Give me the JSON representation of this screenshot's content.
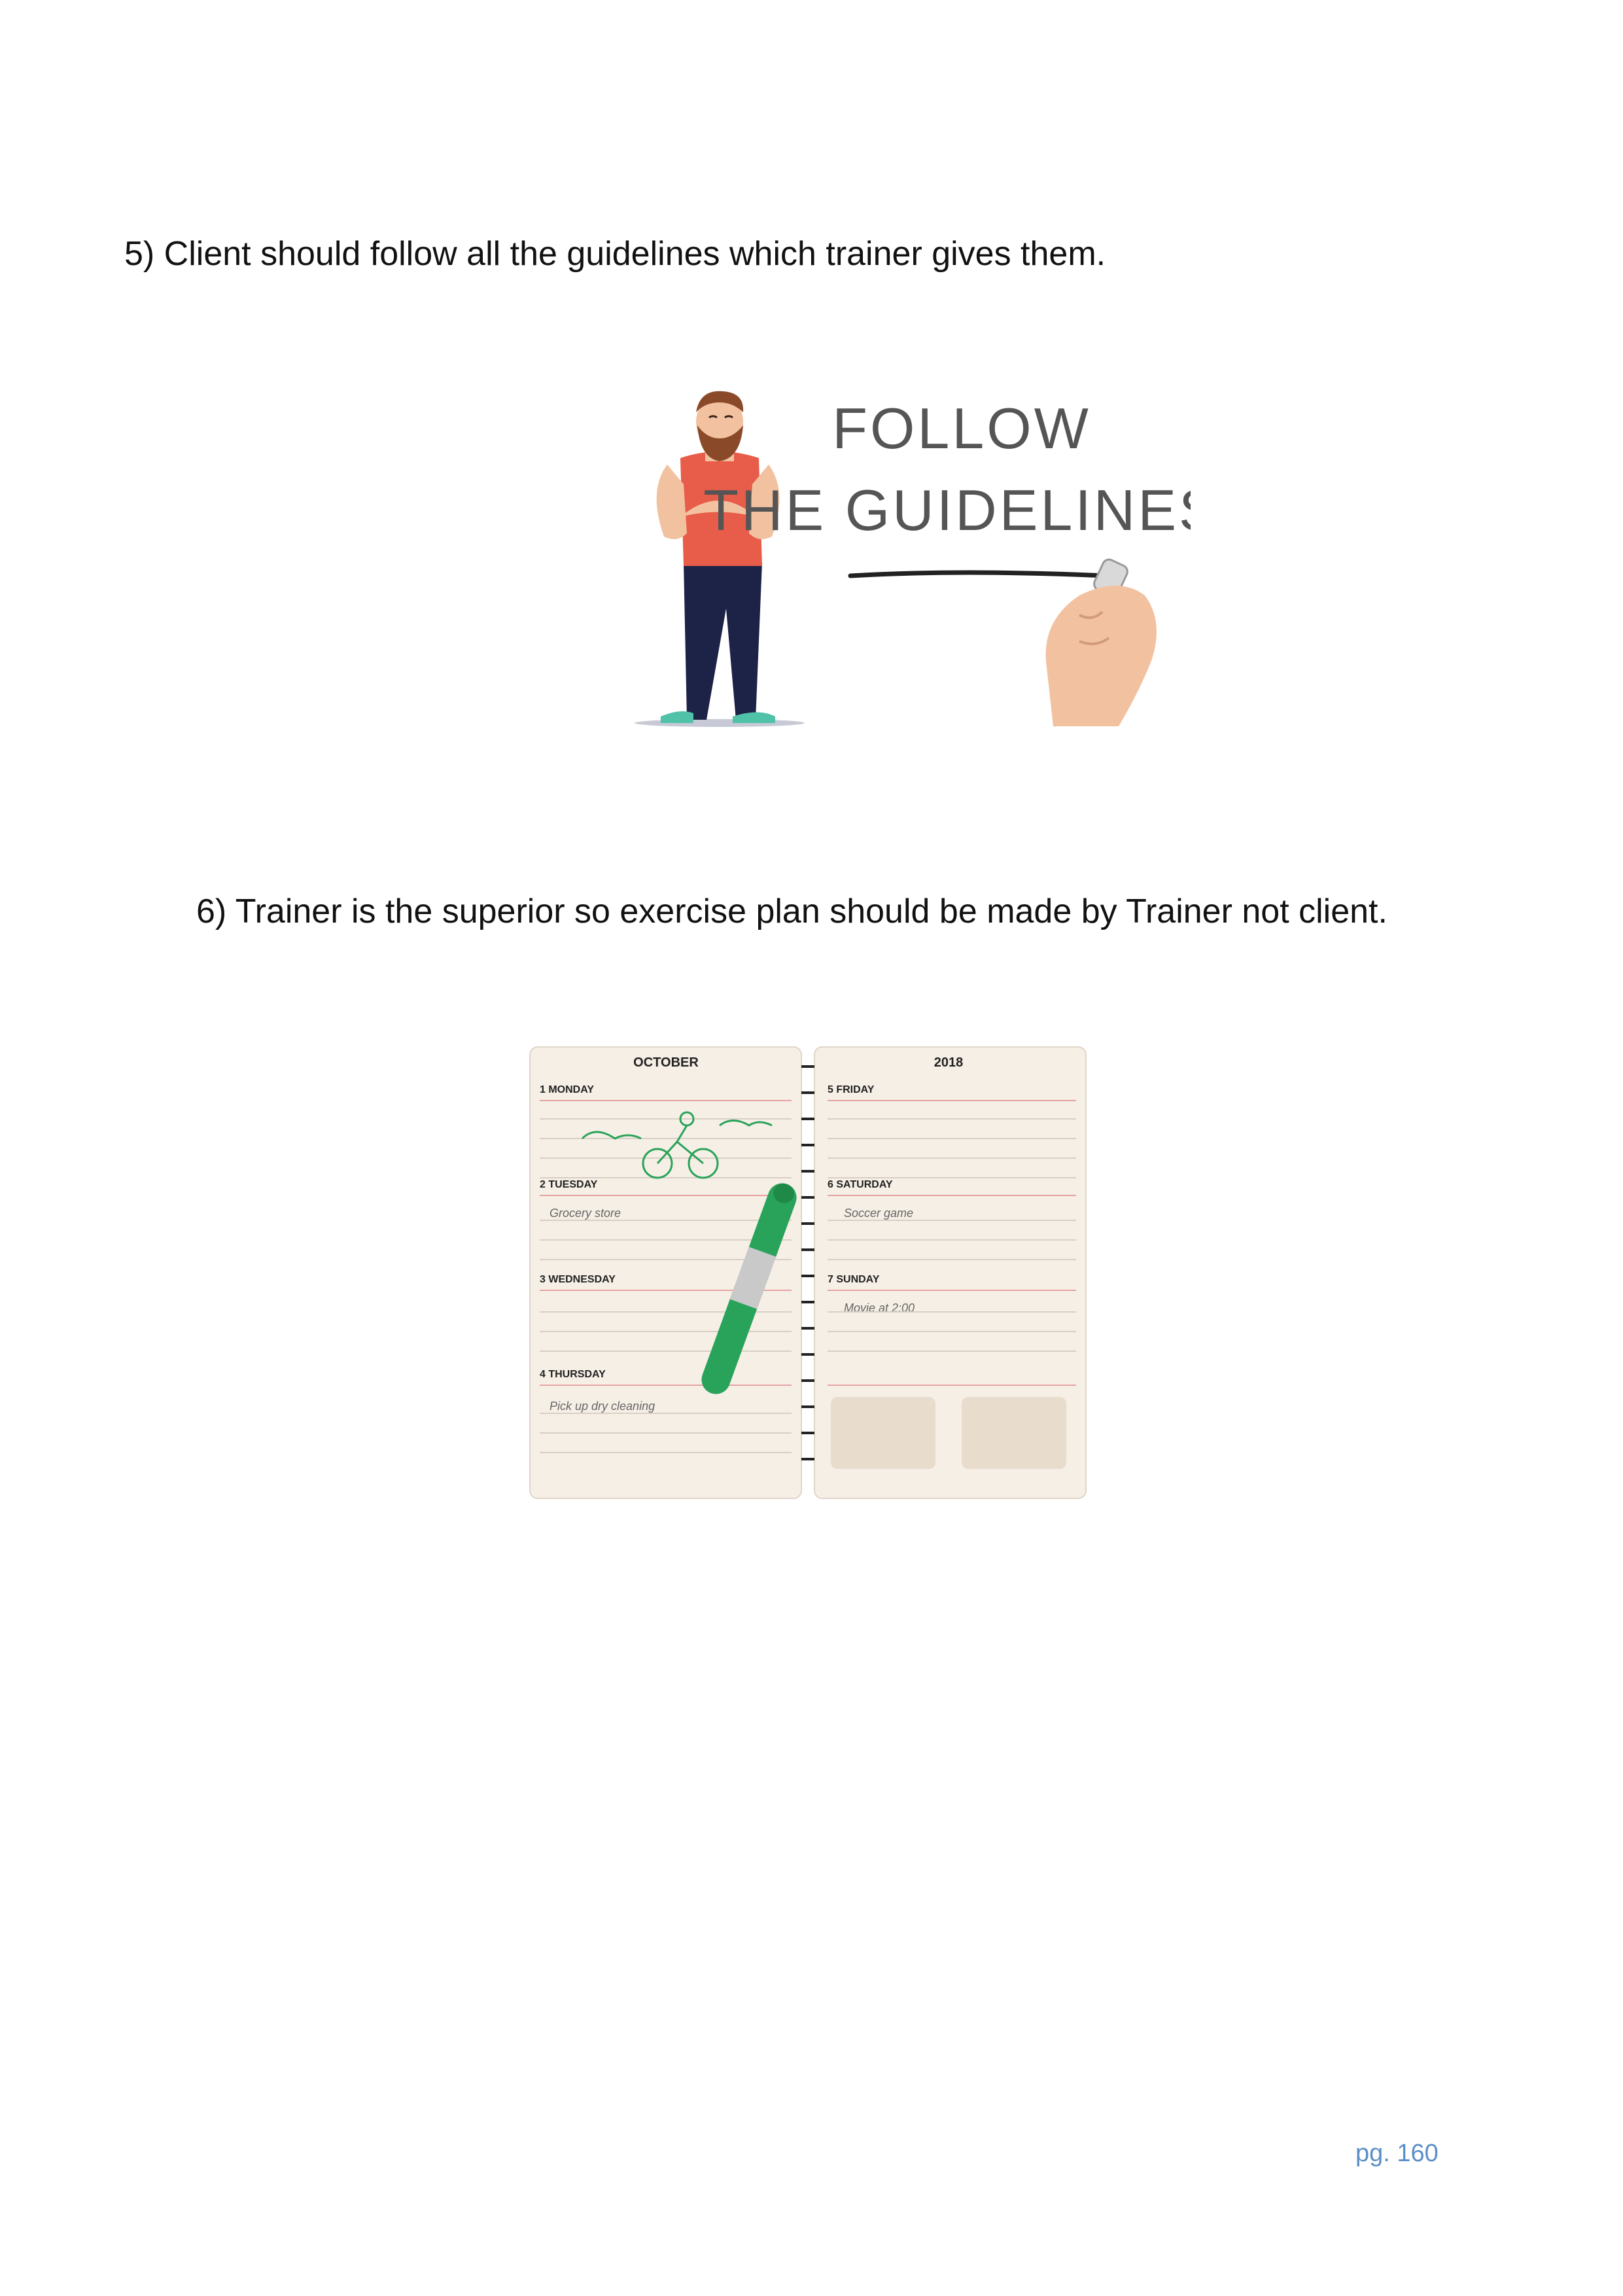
{
  "document": {
    "paragraphs": [
      {
        "text": "5) Client should follow all the guidelines which trainer gives them."
      },
      {
        "text": "6) Trainer is the superior so exercise plan should be made by Trainer not client."
      }
    ],
    "page_number": "pg. 160"
  },
  "illustration_follow": {
    "heading_line1": "FOLLOW",
    "heading_line2": "THE GUIDELINES",
    "colors": {
      "shirt": "#e85c4a",
      "pants": "#1d2247",
      "shoes": "#4fc2a7",
      "beard": "#8a4a2a",
      "skin": "#f2c2a0"
    }
  },
  "illustration_planner": {
    "month": "OCTOBER",
    "year": "2018",
    "left_days": [
      {
        "label": "1  MONDAY",
        "note": ""
      },
      {
        "label": "2  TUESDAY",
        "note": "Grocery store"
      },
      {
        "label": "3  WEDNESDAY",
        "note": ""
      },
      {
        "label": "4  THURSDAY",
        "note": "Pick up dry cleaning"
      }
    ],
    "right_days": [
      {
        "label": "5  FRIDAY",
        "note": ""
      },
      {
        "label": "6  SATURDAY",
        "note": "Soccer game"
      },
      {
        "label": "7  SUNDAY",
        "note": "Movie at 2:00"
      }
    ],
    "colors": {
      "paper": "#f6efe6",
      "rule": "#e6a3a3",
      "pen": "#2aa35a",
      "box": "#e8dccd"
    }
  }
}
